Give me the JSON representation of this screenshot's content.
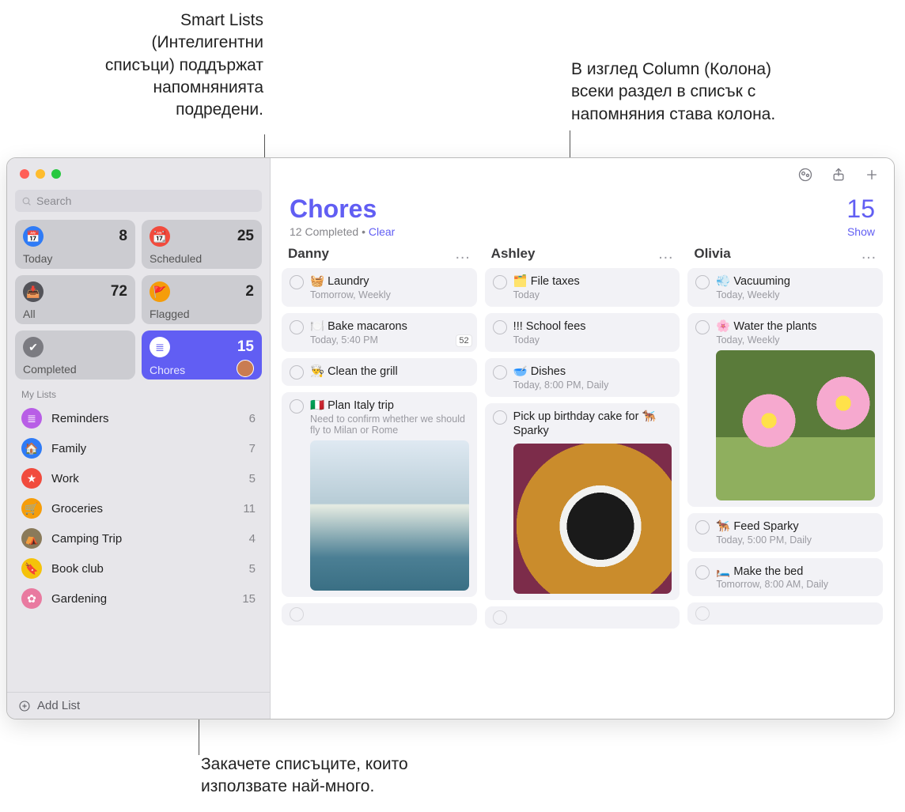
{
  "callouts": {
    "smartlists": "Smart Lists\n(Интелигентни\nсписъци) поддържат\nнапомнянията\nподредени.",
    "columnview": "В изглед Column (Колона)\nвсеки раздел в списък с\nнапомняния става колона.",
    "pinlists": "Закачете списъците, които\nизползвате най-много."
  },
  "search_placeholder": "Search",
  "smartCards": [
    {
      "key": "today",
      "label": "Today",
      "count": 8,
      "color": "#2f7bf6",
      "glyph": "📅"
    },
    {
      "key": "scheduled",
      "label": "Scheduled",
      "count": 25,
      "color": "#f14b3d",
      "glyph": "📆"
    },
    {
      "key": "all",
      "label": "All",
      "count": 72,
      "color": "#535359",
      "glyph": "📥"
    },
    {
      "key": "flagged",
      "label": "Flagged",
      "count": 2,
      "color": "#f59d0a",
      "glyph": "🚩"
    },
    {
      "key": "completed",
      "label": "Completed",
      "count": "",
      "color": "#7b7b81",
      "glyph": "✔"
    },
    {
      "key": "chores",
      "label": "Chores",
      "count": 15,
      "color": "#615ef3",
      "glyph": "≣",
      "active": true,
      "avatar": true
    }
  ],
  "myListsLabel": "My Lists",
  "myLists": [
    {
      "name": "Reminders",
      "count": 6,
      "color": "#b85ee6",
      "glyph": "≣"
    },
    {
      "name": "Family",
      "count": 7,
      "color": "#2f7bf6",
      "glyph": "🏠"
    },
    {
      "name": "Work",
      "count": 5,
      "color": "#f14b3d",
      "glyph": "★"
    },
    {
      "name": "Groceries",
      "count": 11,
      "color": "#f59d0a",
      "glyph": "🛒"
    },
    {
      "name": "Camping Trip",
      "count": 4,
      "color": "#8a7a5a",
      "glyph": "⛺"
    },
    {
      "name": "Book club",
      "count": 5,
      "color": "#f5c20a",
      "glyph": "🔖"
    },
    {
      "name": "Gardening",
      "count": 15,
      "color": "#e97aa0",
      "glyph": "✿"
    }
  ],
  "addList": "Add List",
  "header": {
    "title": "Chores",
    "count": 15,
    "completedLine": "12 Completed",
    "sep": " • ",
    "clear": "Clear",
    "show": "Show"
  },
  "columns": [
    {
      "name": "Danny",
      "tasks": [
        {
          "emoji": "🧺",
          "title": "Laundry",
          "meta": "Tomorrow, Weekly"
        },
        {
          "emoji": "🍽️",
          "title": "Bake macarons",
          "meta": "Today, 5:40 PM",
          "badge": "52"
        },
        {
          "emoji": "👨‍🍳",
          "title": "Clean the grill"
        },
        {
          "emoji": "🇮🇹",
          "title": "Plan Italy trip",
          "meta": "Need to confirm whether we should fly to Milan or Rome",
          "thumb": "coast"
        }
      ],
      "emptyBelow": true
    },
    {
      "name": "Ashley",
      "tasks": [
        {
          "emoji": "🗂️",
          "title": "File taxes",
          "meta": "Today"
        },
        {
          "emoji": "",
          "title": "!!! School fees",
          "meta": "Today"
        },
        {
          "emoji": "🥣",
          "title": "Dishes",
          "meta": "Today, 8:00 PM, Daily"
        },
        {
          "emoji": "",
          "title": "Pick up birthday cake for 🐕‍🦺 Sparky",
          "thumb": "dog"
        }
      ],
      "emptyBelow": true
    },
    {
      "name": "Olivia",
      "tasks": [
        {
          "emoji": "💨",
          "title": "Vacuuming",
          "meta": "Today, Weekly"
        },
        {
          "emoji": "🌸",
          "title": "Water the plants",
          "meta": "Today, Weekly",
          "thumb": "flower"
        },
        {
          "emoji": "🐕‍🦺",
          "title": "Feed Sparky",
          "meta": "Today, 5:00 PM, Daily"
        },
        {
          "emoji": "🛏️",
          "title": "Make the bed",
          "meta": "Tomorrow, 8:00 AM, Daily"
        }
      ],
      "emptyBelow": true
    }
  ]
}
